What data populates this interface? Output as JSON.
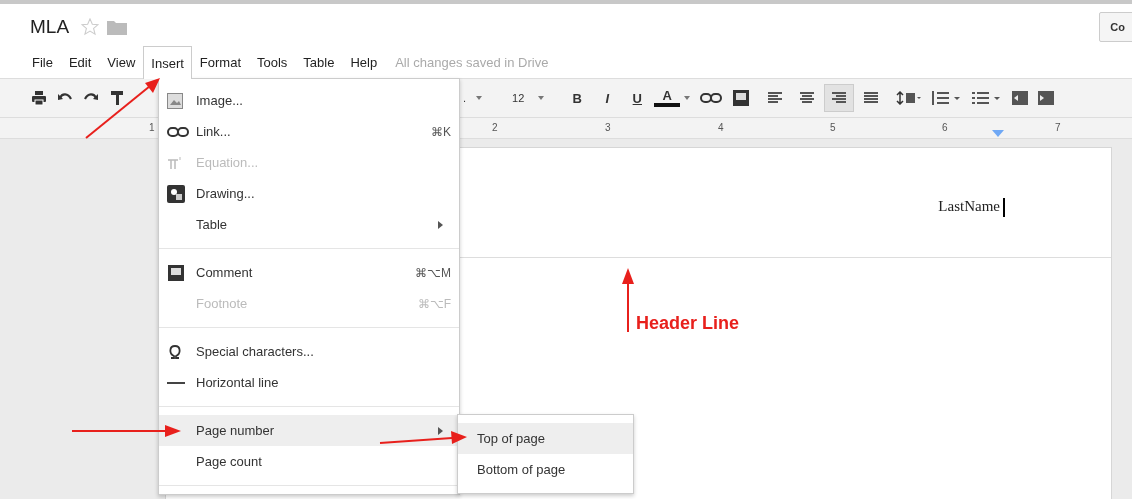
{
  "document": {
    "title": "MLA",
    "starred": false
  },
  "menubar": [
    {
      "label": "File",
      "selected": false
    },
    {
      "label": "Edit",
      "selected": false
    },
    {
      "label": "View",
      "selected": false
    },
    {
      "label": "Insert",
      "selected": true
    },
    {
      "label": "Format",
      "selected": false
    },
    {
      "label": "Tools",
      "selected": false
    },
    {
      "label": "Table",
      "selected": false
    },
    {
      "label": "Help",
      "selected": false
    }
  ],
  "save_status": "All changes saved in Drive",
  "top_right_button": "Co",
  "toolbar": {
    "font_fragment": ".",
    "font_size": "12",
    "format_buttons": [
      "B",
      "I",
      "U",
      "A"
    ],
    "align_buttons": [
      {
        "selected": false
      },
      {
        "selected": false
      },
      {
        "selected": true
      },
      {
        "selected": false
      }
    ]
  },
  "ruler": [
    "1",
    "2",
    "3",
    "4",
    "5",
    "6",
    "7"
  ],
  "insert_menu": [
    {
      "kind": "item",
      "label": "Image...",
      "disabled": false,
      "submenu": false,
      "highlighted": false
    },
    {
      "kind": "item",
      "label": "Link...",
      "shortcut": "⌘K",
      "disabled": false,
      "submenu": false,
      "highlighted": false
    },
    {
      "kind": "item",
      "label": "Equation...",
      "disabled": true,
      "submenu": false,
      "highlighted": false
    },
    {
      "kind": "item",
      "label": "Drawing...",
      "disabled": false,
      "submenu": false,
      "highlighted": false
    },
    {
      "kind": "item",
      "label": "Table",
      "disabled": false,
      "submenu": true,
      "highlighted": false
    },
    {
      "kind": "separator"
    },
    {
      "kind": "item",
      "label": "Comment",
      "shortcut": "⌘⌥M",
      "disabled": false,
      "submenu": false,
      "highlighted": false
    },
    {
      "kind": "item",
      "label": "Footnote",
      "shortcut": "⌘⌥F",
      "disabled": true,
      "submenu": false,
      "highlighted": false
    },
    {
      "kind": "separator"
    },
    {
      "kind": "item",
      "label": "Special characters...",
      "disabled": false,
      "submenu": false,
      "highlighted": false
    },
    {
      "kind": "item",
      "label": "Horizontal line",
      "disabled": false,
      "submenu": false,
      "highlighted": false
    },
    {
      "kind": "separator"
    },
    {
      "kind": "item",
      "label": "Page number",
      "disabled": false,
      "submenu": true,
      "highlighted": true
    },
    {
      "kind": "item",
      "label": "Page count",
      "disabled": false,
      "submenu": false,
      "highlighted": false
    },
    {
      "kind": "separator"
    }
  ],
  "page_number_submenu": [
    {
      "label": "Top of page",
      "selected": true
    },
    {
      "label": "Bottom of page",
      "selected": false
    }
  ],
  "page": {
    "header_text": "LastName"
  },
  "annotation": "Header Line"
}
